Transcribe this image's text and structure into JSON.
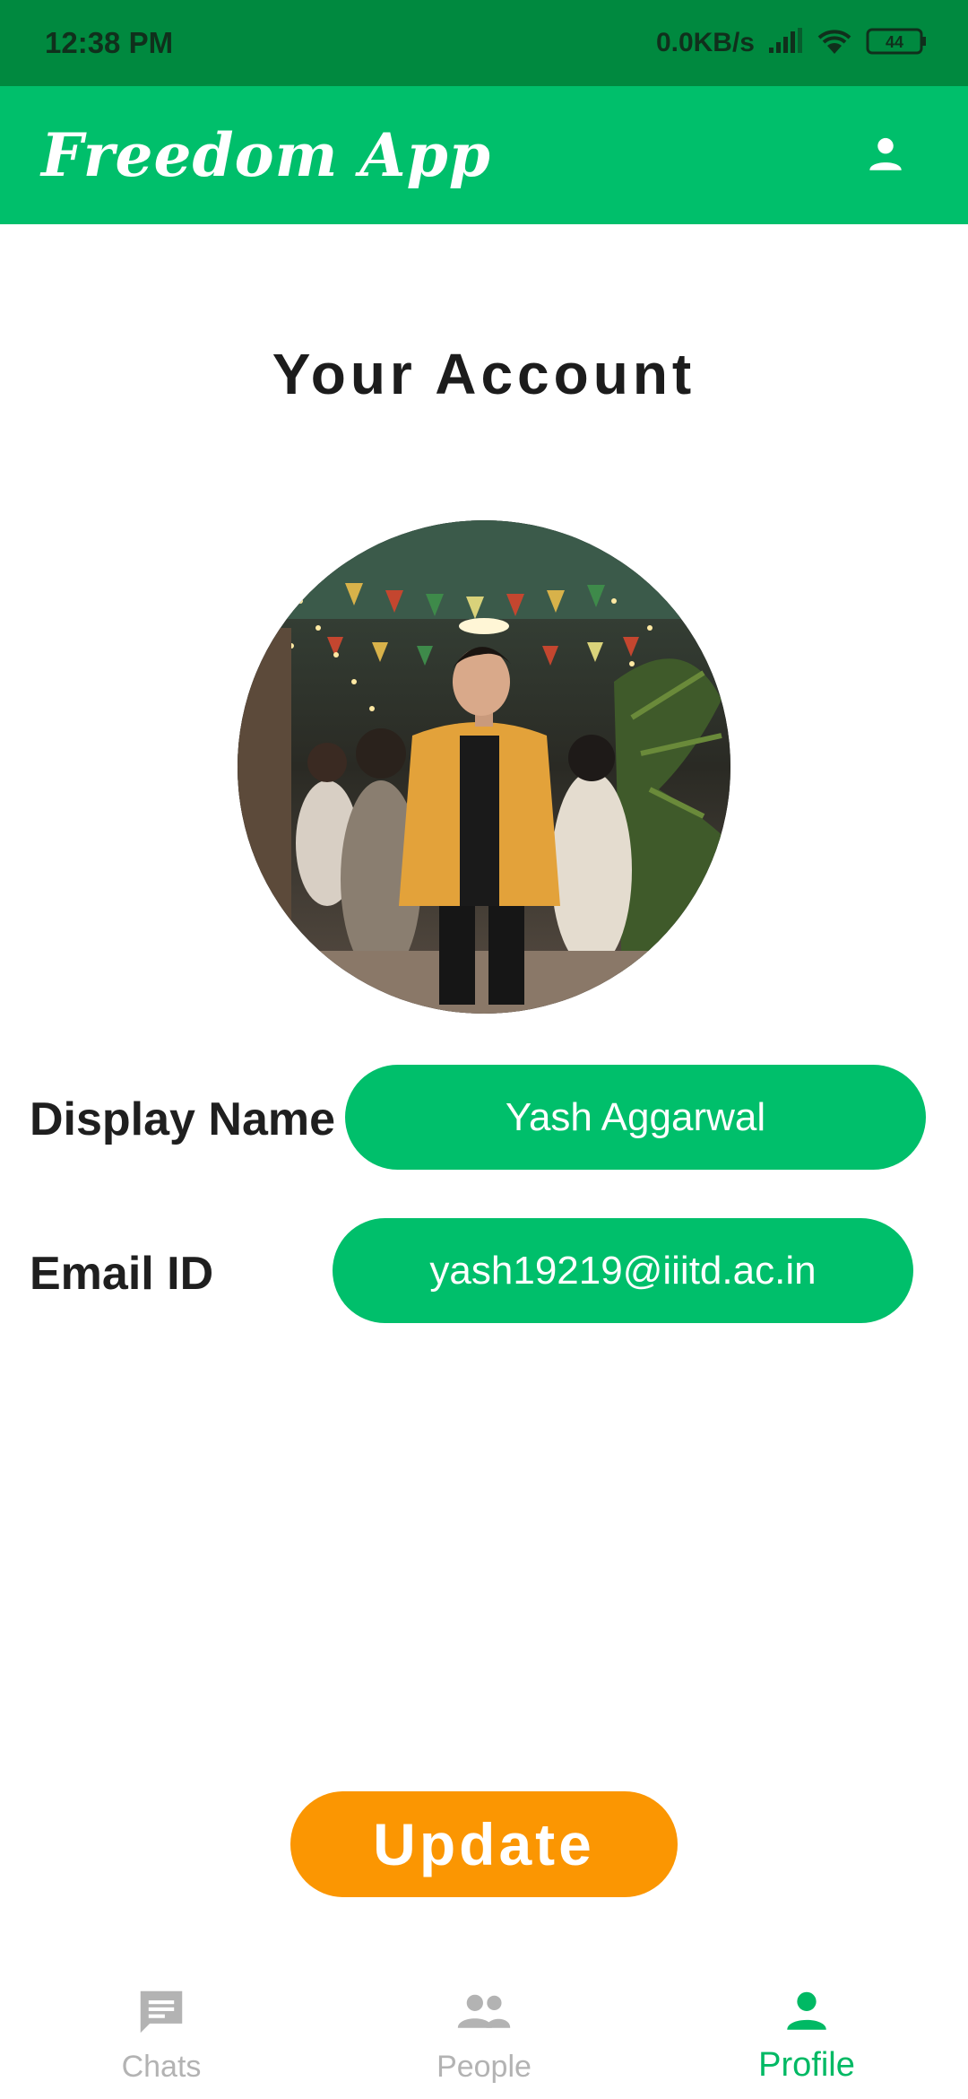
{
  "status_bar": {
    "time": "12:38 PM",
    "network_speed": "0.0KB/s",
    "battery": "44"
  },
  "app_bar": {
    "title": "Freedom App",
    "profile_icon": "person-icon"
  },
  "page": {
    "title": "Your Account"
  },
  "profile": {
    "display_name_label": "Display Name",
    "display_name_value": "Yash Aggarwal",
    "email_label": "Email ID",
    "email_value": "yash19219@iiitd.ac.in"
  },
  "actions": {
    "update_label": "Update"
  },
  "bottom_nav": {
    "items": [
      {
        "label": "Chats",
        "icon": "chat-icon",
        "active": false
      },
      {
        "label": "People",
        "icon": "people-icon",
        "active": false
      },
      {
        "label": "Profile",
        "icon": "person-icon",
        "active": true
      }
    ]
  },
  "colors": {
    "primary": "#00bf6b",
    "status_bar": "#00893f",
    "accent": "#fb9602",
    "inactive": "#b3b3b3"
  }
}
